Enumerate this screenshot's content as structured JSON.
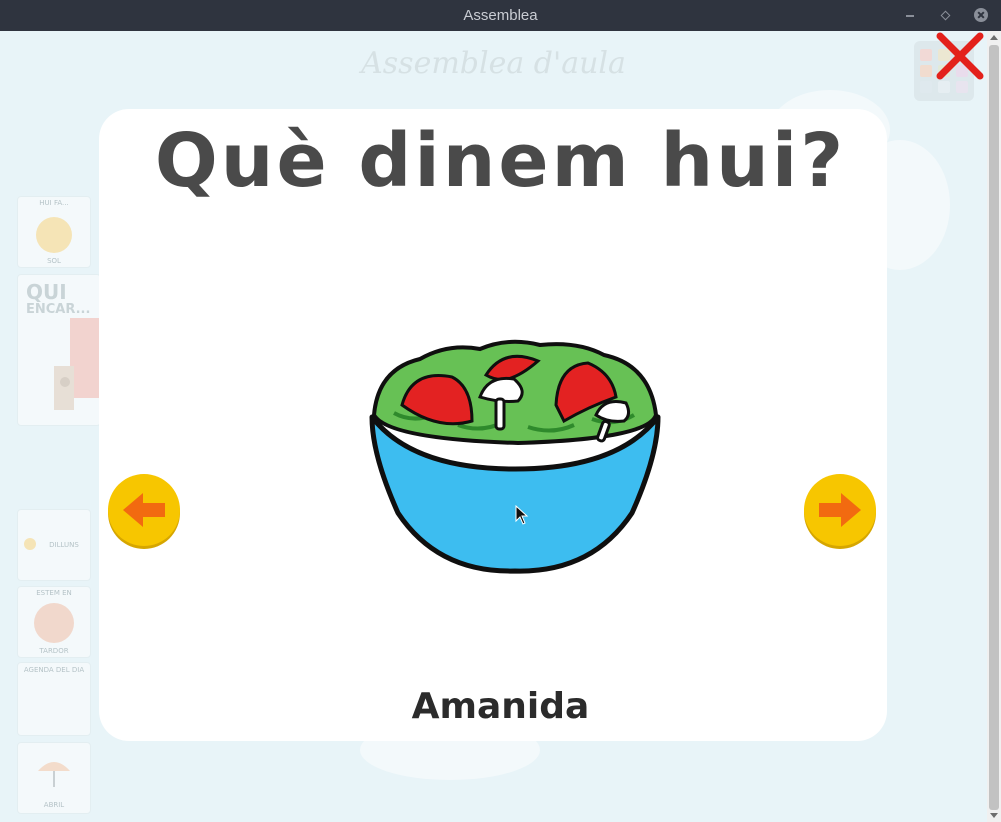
{
  "window": {
    "title": "Assemblea"
  },
  "background_app": {
    "title": "Assemblea d'aula",
    "weather_tile": {
      "heading": "HUI FA...",
      "caption": "SOL"
    },
    "who_tile": {
      "line1": "QUI",
      "line2": "ENCAR..."
    },
    "day_tile": {
      "caption": "DILLUNS"
    },
    "place_tile": {
      "heading": "ESTEM EN",
      "caption": "TARDOR"
    },
    "agenda_tile": {
      "heading": "AGENDA DEL DIA"
    },
    "month_tile": {
      "caption": "ABRIL"
    }
  },
  "modal": {
    "question": "Què dinem hui?",
    "food_name": "Amanida",
    "food_icon": "salad-bowl-icon",
    "prev_icon": "arrow-left-icon",
    "next_icon": "arrow-right-icon",
    "close_icon": "close-x-icon"
  },
  "colors": {
    "titlebar": "#2f343f",
    "card": "#ffffff",
    "bowl": "#3dbdf0",
    "nav_button": "#f7c600",
    "nav_arrow": "#f26a10",
    "close_x": "#e3211b"
  }
}
